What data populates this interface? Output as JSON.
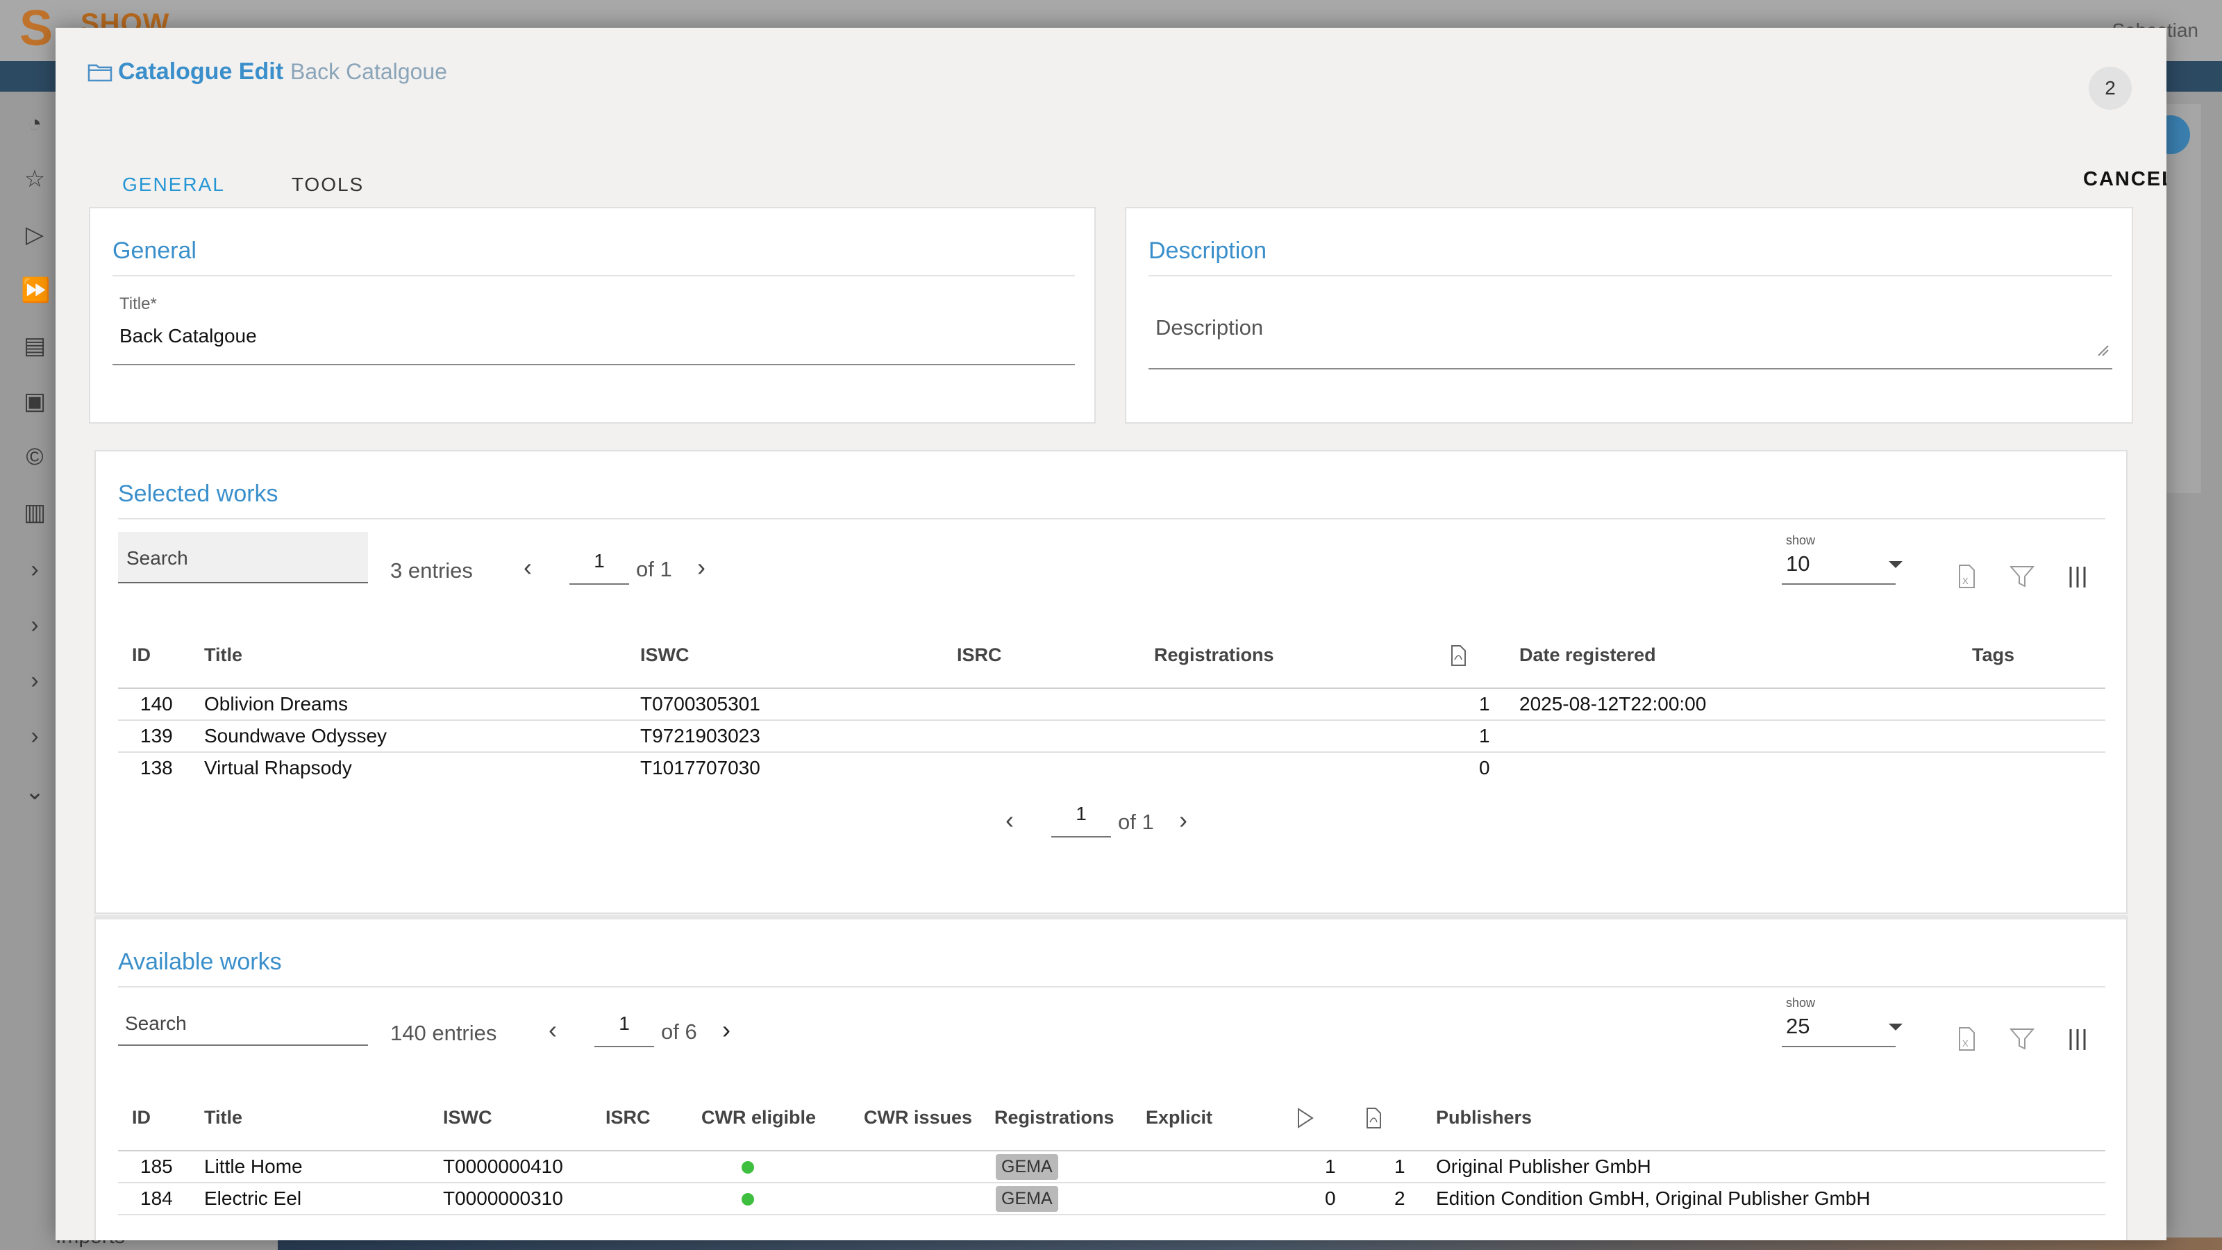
{
  "background": {
    "logo_text": "SHOW",
    "user_name_partial": "Sebastian",
    "imports_label": "Imports"
  },
  "modal": {
    "title": "Catalogue Edit",
    "subtitle": "Back Catalgoue",
    "badge_count": "2",
    "tabs": [
      {
        "label": "GENERAL",
        "active": true
      },
      {
        "label": "TOOLS",
        "active": false
      }
    ],
    "cancel_label": "CANCEL"
  },
  "general": {
    "heading": "General",
    "title_label": "Title*",
    "title_value": "Back Catalgoue"
  },
  "description": {
    "heading": "Description",
    "placeholder": "Description"
  },
  "selected_works": {
    "heading": "Selected works",
    "search_placeholder": "Search",
    "entries": "3 entries",
    "page": "1",
    "of_pages": "of 1",
    "show_label": "show",
    "show_value": "10",
    "columns": [
      "ID",
      "Title",
      "ISWC",
      "ISRC",
      "Registrations",
      "Date registered",
      "Tags"
    ],
    "rows": [
      {
        "id": "140",
        "title": "Oblivion Dreams",
        "iswc": "T0700305301",
        "count": "1",
        "date": "2025-08-12T22:00:00"
      },
      {
        "id": "139",
        "title": "Soundwave Odyssey",
        "iswc": "T9721903023",
        "count": "1",
        "date": ""
      },
      {
        "id": "138",
        "title": "Virtual Rhapsody",
        "iswc": "T1017707030",
        "count": "0",
        "date": ""
      }
    ],
    "bottom_page": "1",
    "bottom_of_pages": "of 1"
  },
  "available_works": {
    "heading": "Available works",
    "search_placeholder": "Search",
    "entries": "140 entries",
    "page": "1",
    "of_pages": "of 6",
    "show_label": "show",
    "show_value": "25",
    "columns": [
      "ID",
      "Title",
      "ISWC",
      "ISRC",
      "CWR eligible",
      "CWR issues",
      "Registrations",
      "Explicit",
      "Publishers"
    ],
    "rows": [
      {
        "id": "185",
        "title": "Little Home",
        "iswc": "T0000000410",
        "registration": "GEMA",
        "plays": "1",
        "docs": "1",
        "publishers": "Original Publisher GmbH"
      },
      {
        "id": "184",
        "title": "Electric Eel",
        "iswc": "T0000000310",
        "registration": "GEMA",
        "plays": "0",
        "docs": "2",
        "publishers": "Edition Condition GmbH, Original Publisher GmbH"
      }
    ]
  },
  "colors": {
    "accent": "#3a8fcb",
    "tab_active": "#2596d4",
    "eligible_dot": "#3fbf3f"
  }
}
